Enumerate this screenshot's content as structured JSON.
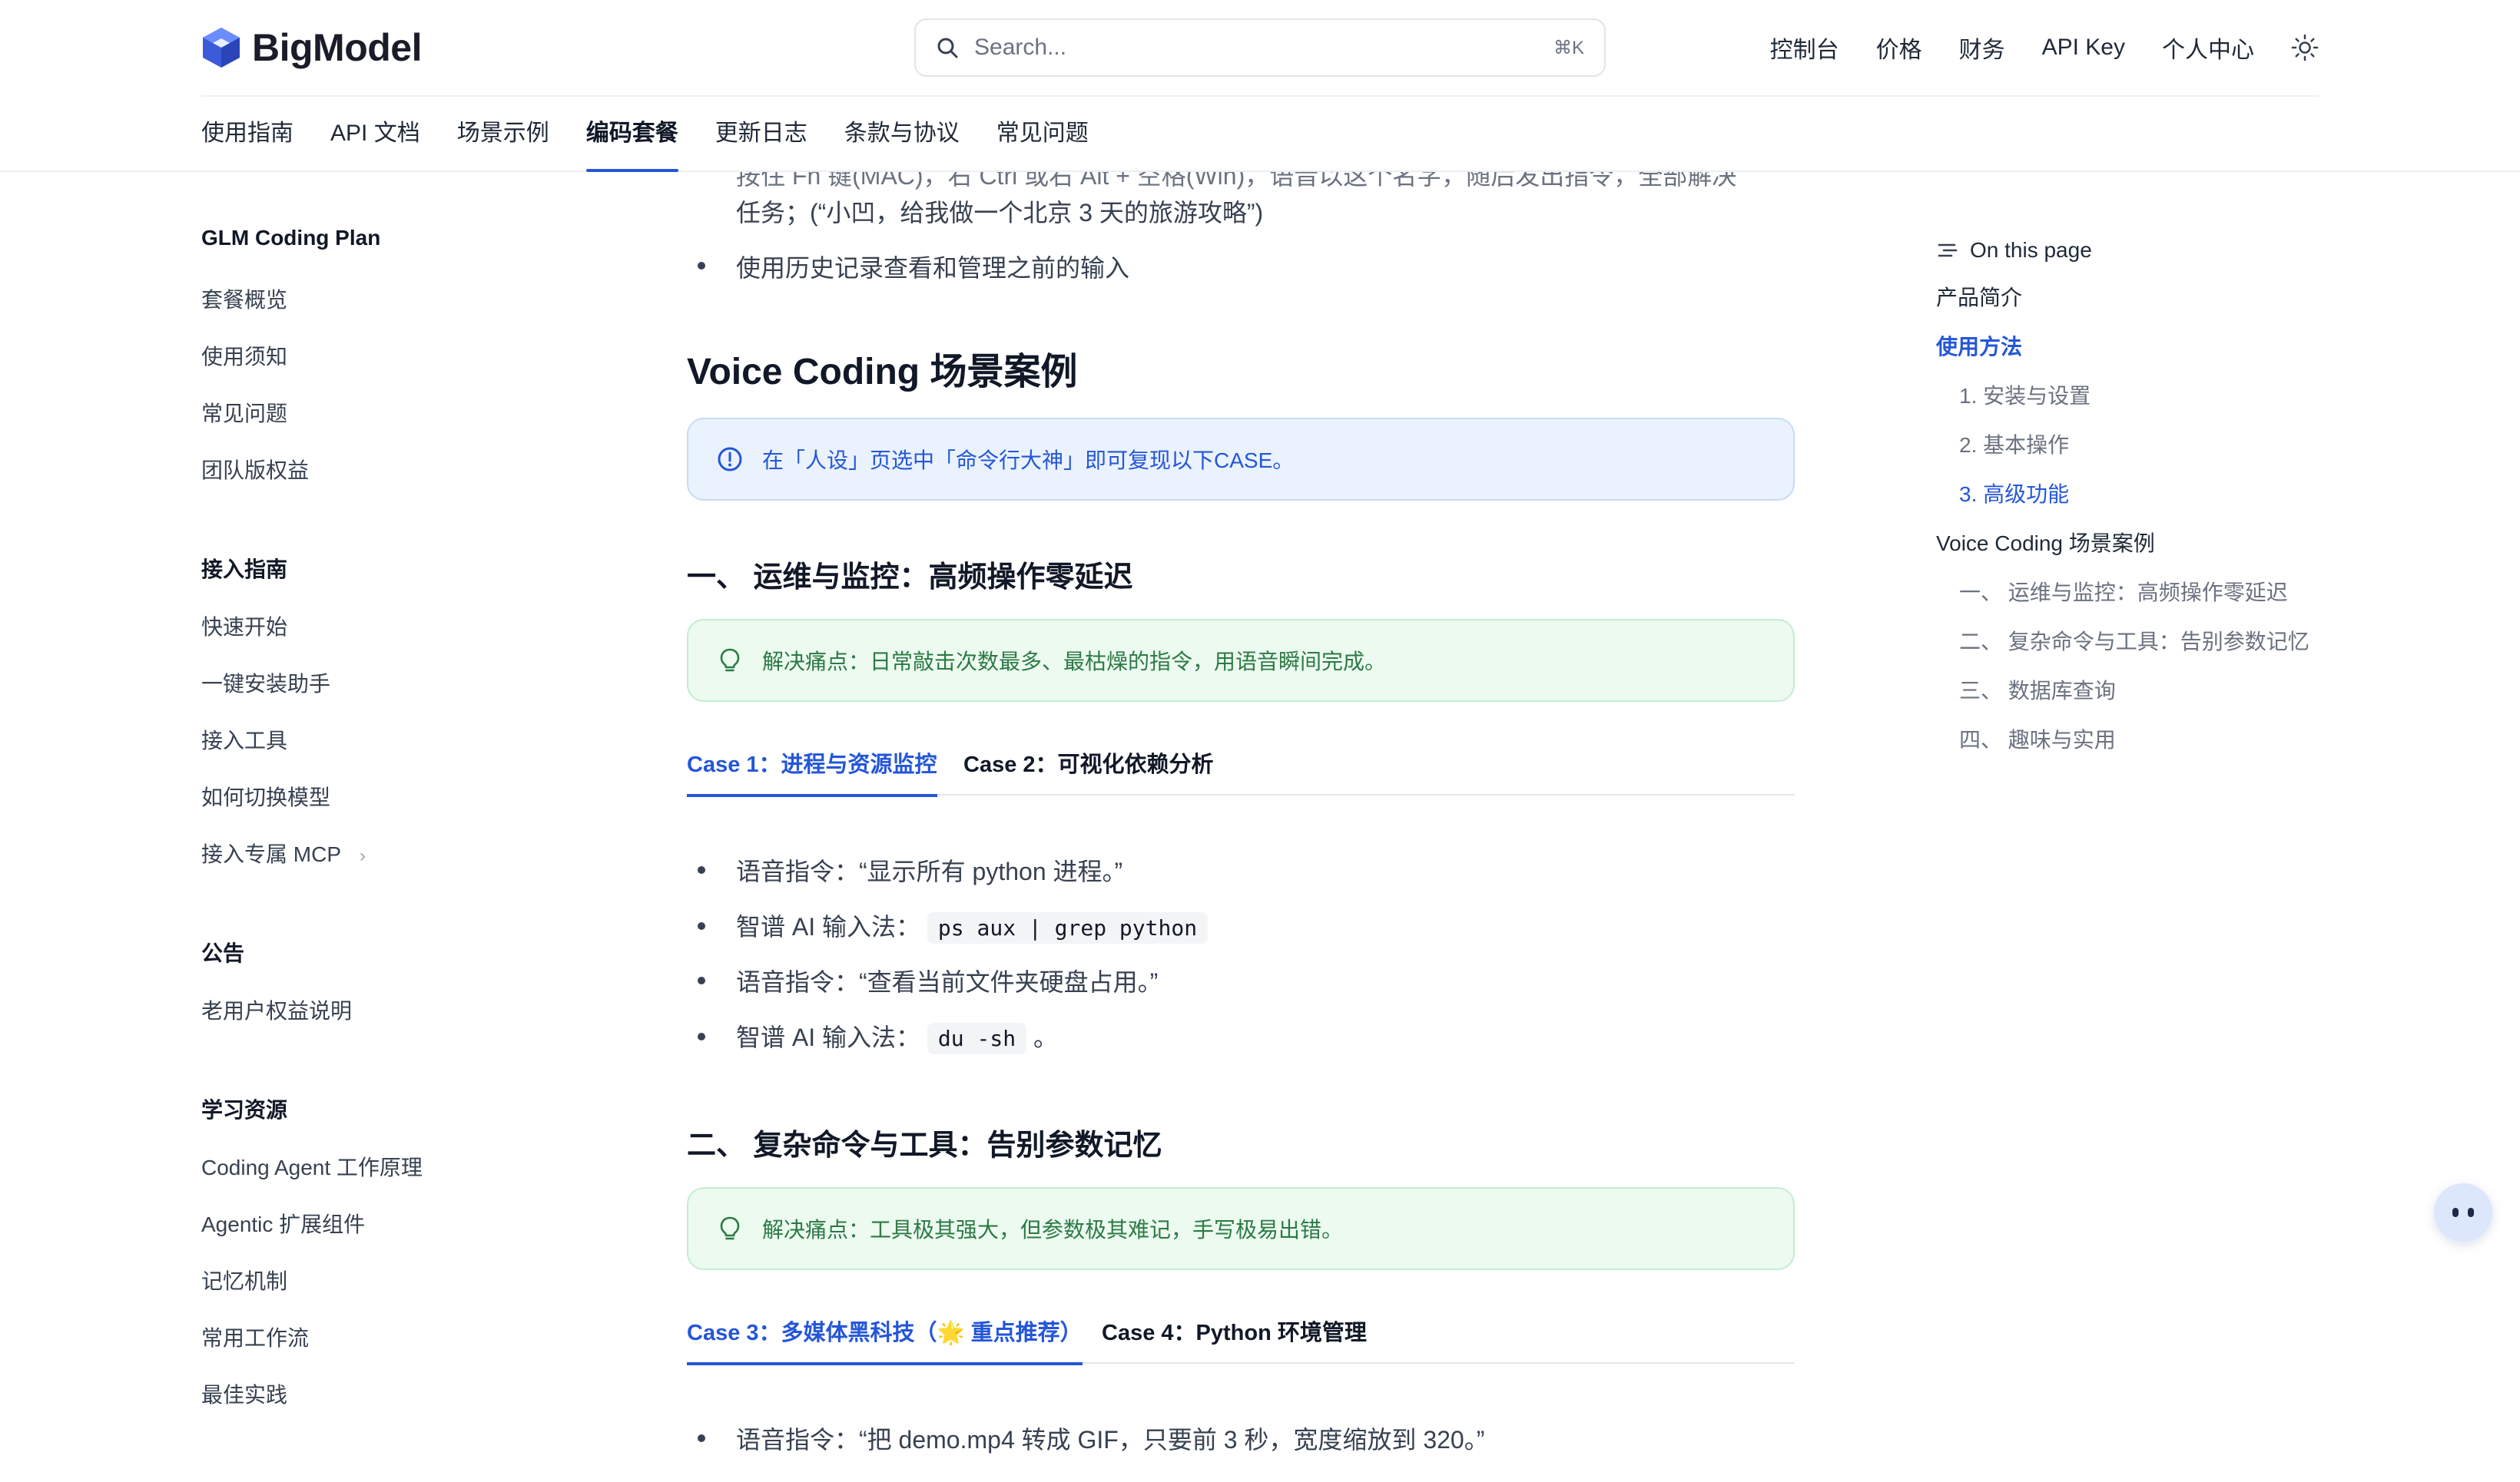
{
  "header": {
    "logo_text": "BigModel",
    "search_placeholder": "Search...",
    "search_shortcut": "⌘K",
    "nav": [
      "控制台",
      "价格",
      "财务",
      "API Key",
      "个人中心"
    ],
    "tabs": [
      "使用指南",
      "API 文档",
      "场景示例",
      "编码套餐",
      "更新日志",
      "条款与协议",
      "常见问题"
    ],
    "active_tab": "编码套餐",
    "brand_color": "#2456d8"
  },
  "sidebar": {
    "groups": [
      {
        "title": "GLM Coding Plan",
        "items": [
          "套餐概览",
          "使用须知",
          "常见问题",
          "团队版权益"
        ]
      },
      {
        "title": "接入指南",
        "items": [
          "快速开始",
          "一键安装助手",
          "接入工具",
          "如何切换模型",
          "接入专属 MCP"
        ]
      },
      {
        "title": "公告",
        "items": [
          "老用户权益说明"
        ]
      },
      {
        "title": "学习资源",
        "items": [
          "Coding Agent 工作原理",
          "Agentic 扩展组件",
          "记忆机制",
          "常用工作流",
          "最佳实践"
        ]
      }
    ],
    "expandable_item": "接入专属 MCP"
  },
  "content": {
    "top_partial": "按住 Fn 键(MAC)，右 Ctrl 或右 Alt + 空格(Win)，语音以这个名字，随后发出指令，全部解决",
    "top_text": "任务；(“小凹，给我做一个北京 3 天的旅游攻略”)",
    "history_bullet": "使用历史记录查看和管理之前的输入",
    "h2": "Voice Coding 场景案例",
    "info_callout": "在「人设」页选中「命令行大神」即可复现以下CASE。",
    "section1": {
      "title": "一、 运维与监控：高频操作零延迟",
      "tip": "解决痛点：日常敲击次数最多、最枯燥的指令，用语音瞬间完成。",
      "tabs": [
        "Case 1：进程与资源监控",
        "Case 2：可视化依赖分析"
      ],
      "bullets": [
        {
          "label": "语音指令：“显示所有 python 进程。”",
          "code": ""
        },
        {
          "label": "智谱 AI 输入法：",
          "code": "ps aux | grep python"
        },
        {
          "label": "语音指令：“查看当前文件夹硬盘占用。”",
          "code": ""
        },
        {
          "label": "智谱 AI 输入法：",
          "code": "du -sh",
          "suffix": "。"
        }
      ]
    },
    "section2": {
      "title": "二、 复杂命令与工具：告别参数记忆",
      "tip": "解决痛点：工具极其强大，但参数极其难记，手写极易出错。",
      "tabs": [
        "Case 3：多媒体黑科技（🌟 重点推荐）",
        "Case 4：Python 环境管理"
      ],
      "bullets": [
        {
          "label": "语音指令：“把 demo.mp4 转成 GIF，只要前 3 秒，宽度缩放到 320。”",
          "code": ""
        }
      ]
    }
  },
  "toc": {
    "title": "On this page",
    "items": [
      {
        "label": "产品简介",
        "level": 1,
        "active": false
      },
      {
        "label": "使用方法",
        "level": 1,
        "active": true
      },
      {
        "label": "1. 安装与设置",
        "level": 2,
        "active": false
      },
      {
        "label": "2. 基本操作",
        "level": 2,
        "active": false
      },
      {
        "label": "3. 高级功能",
        "level": 2,
        "active": true
      },
      {
        "label": "Voice Coding 场景案例",
        "level": 1,
        "active": false
      },
      {
        "label": "一、 运维与监控：高频操作零延迟",
        "level": 2,
        "active": false
      },
      {
        "label": "二、 复杂命令与工具：告别参数记忆",
        "level": 2,
        "active": false
      },
      {
        "label": "三、 数据库查询",
        "level": 2,
        "active": false
      },
      {
        "label": "四、 趣味与实用",
        "level": 2,
        "active": false
      }
    ]
  }
}
